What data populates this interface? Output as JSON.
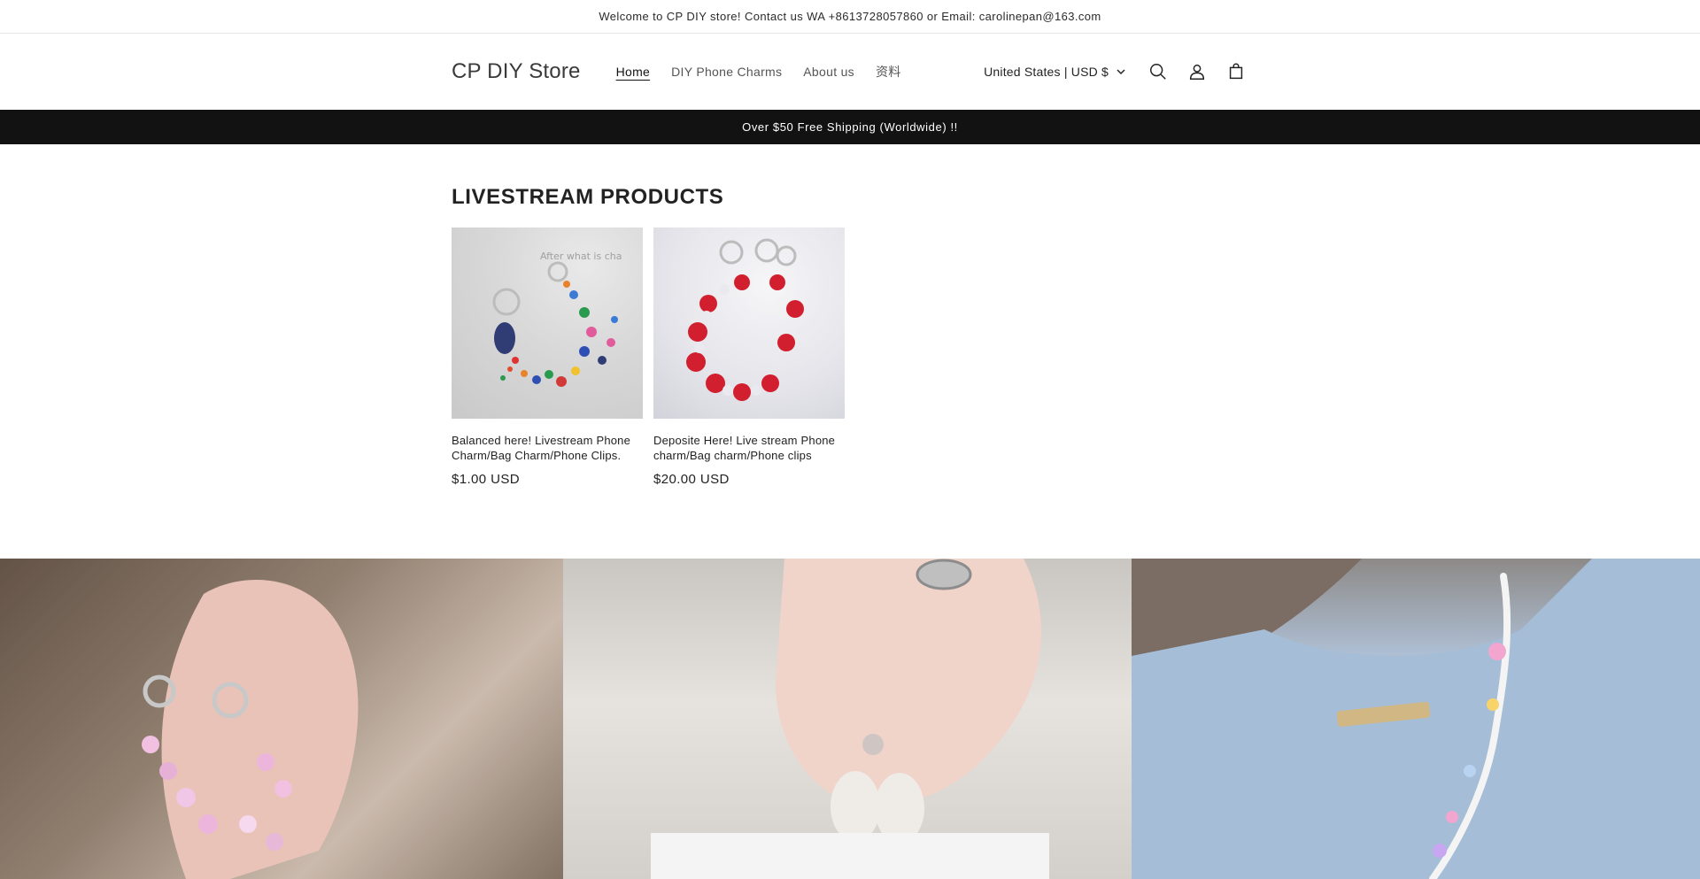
{
  "topbar": {
    "text": "Welcome to CP DIY store! Contact us WA +8613728057860 or Email: carolinepan@163.com"
  },
  "header": {
    "logo": "CP DIY Store",
    "nav": [
      {
        "label": "Home",
        "active": true
      },
      {
        "label": "DIY Phone Charms",
        "active": false
      },
      {
        "label": "About us",
        "active": false
      },
      {
        "label": "资料",
        "active": false
      }
    ],
    "currency": "United States | USD $",
    "icons": [
      "search-icon",
      "account-icon",
      "cart-icon",
      "chevron-down-icon"
    ]
  },
  "announcement": {
    "text": "Over $50 Free Shipping (Worldwide) !!"
  },
  "section": {
    "title": "LIVESTREAM PRODUCTS",
    "products": [
      {
        "title": "Balanced here! Livestream Phone Charm/Bag Charm/Phone Clips.",
        "price": "$1.00 USD",
        "image_watermark": "After what is cha"
      },
      {
        "title": "Deposite Here! Live stream Phone charm/Bag charm/Phone clips",
        "price": "$20.00 USD"
      }
    ]
  },
  "colors": {
    "dark_bar": "#121212",
    "text": "#121212",
    "muted": "#555555"
  }
}
